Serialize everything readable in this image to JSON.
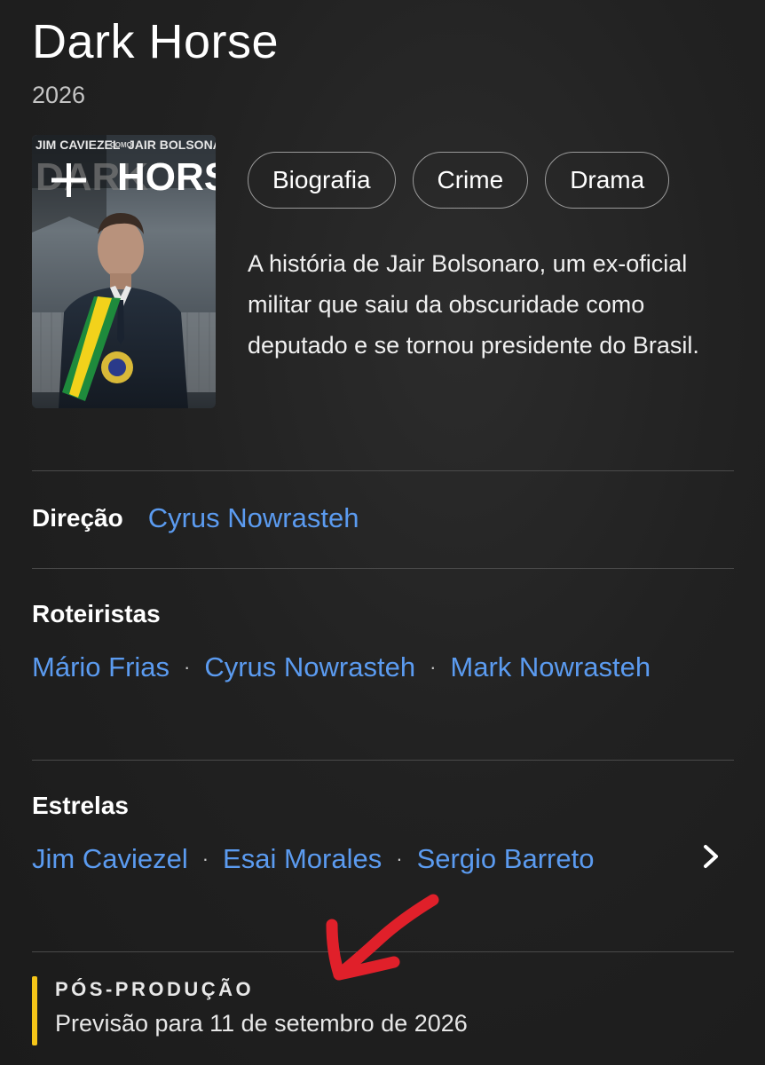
{
  "movie": {
    "title": "Dark Horse",
    "year": "2026",
    "genres": [
      "Biografia",
      "Crime",
      "Drama"
    ],
    "plot": "A história de Jair Bolsonaro, um ex-oficial militar que saiu da obscuridade como deputado e se tornou presidente do Brasil."
  },
  "poster": {
    "top_text_left": "JIM CAVIEZEL",
    "top_text_mid": "COMO",
    "top_text_right": "JAIR BOLSONARO",
    "title_word_1": "DARK",
    "title_word_2": "HORSE",
    "add_icon": "plus-icon"
  },
  "credits": {
    "direction_label": "Direção",
    "director": "Cyrus Nowrasteh",
    "writers_label": "Roteiristas",
    "writers": [
      "Mário Frias",
      "Cyrus Nowrasteh",
      "Mark Nowrasteh"
    ],
    "stars_label": "Estrelas",
    "stars": [
      "Jim Caviezel",
      "Esai Morales",
      "Sergio Barreto"
    ],
    "stars_more_icon": "chevron-right-icon",
    "separator": "·"
  },
  "status": {
    "title": "PÓS-PRODUÇÃO",
    "text": "Previsão para 11 de setembro de 2026",
    "accent_color": "#f5c518"
  },
  "colors": {
    "background": "#1f1f1f",
    "link": "#5b9bf0",
    "annotation_arrow": "#e0202a"
  }
}
